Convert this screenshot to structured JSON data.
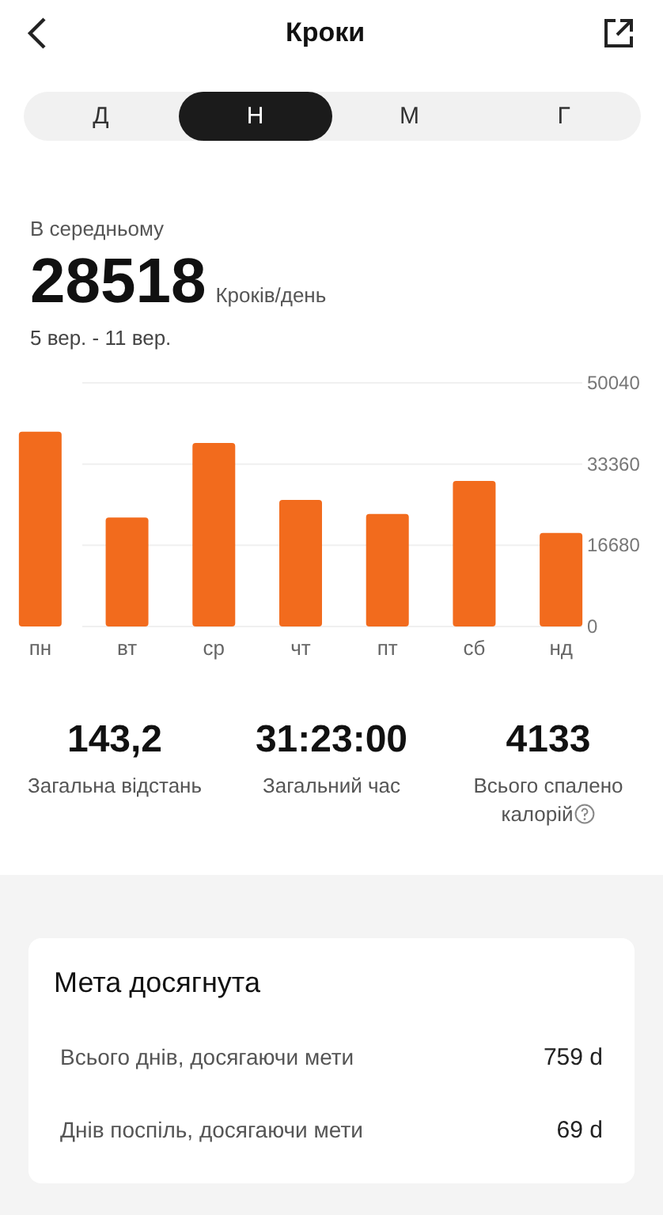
{
  "header": {
    "title": "Кроки"
  },
  "tabs": [
    {
      "label": "Д",
      "selected": false
    },
    {
      "label": "Н",
      "selected": true
    },
    {
      "label": "М",
      "selected": false
    },
    {
      "label": "Г",
      "selected": false
    }
  ],
  "summary": {
    "caption": "В середньому",
    "value": "28518",
    "unit": "Кроків/день",
    "range": "5 вер. - 11 вер."
  },
  "chart_data": {
    "type": "bar",
    "categories": [
      "пн",
      "вт",
      "ср",
      "чт",
      "пт",
      "сб",
      "нд"
    ],
    "series": [
      {
        "color": "#f26b1d",
        "values": [
          40000,
          22400,
          37700,
          26000,
          23100,
          29900,
          19200
        ]
      }
    ],
    "ylim": [
      0,
      50040
    ],
    "yticks": [
      0,
      16680,
      33360,
      50040
    ]
  },
  "stats": [
    {
      "value": "143,2",
      "label": "Загальна відстань",
      "info": false
    },
    {
      "value": "31:23:00",
      "label": "Загальний час",
      "info": false
    },
    {
      "value": "4133",
      "label": "Всього спалено калорій",
      "info": true
    }
  ],
  "goal_card": {
    "title": "Мета досягнута",
    "rows": [
      {
        "label": "Всього днів, досягаючи мети",
        "value": "759 d"
      },
      {
        "label": "Днів поспіль, досягаючи мети",
        "value": "69 d"
      }
    ]
  }
}
